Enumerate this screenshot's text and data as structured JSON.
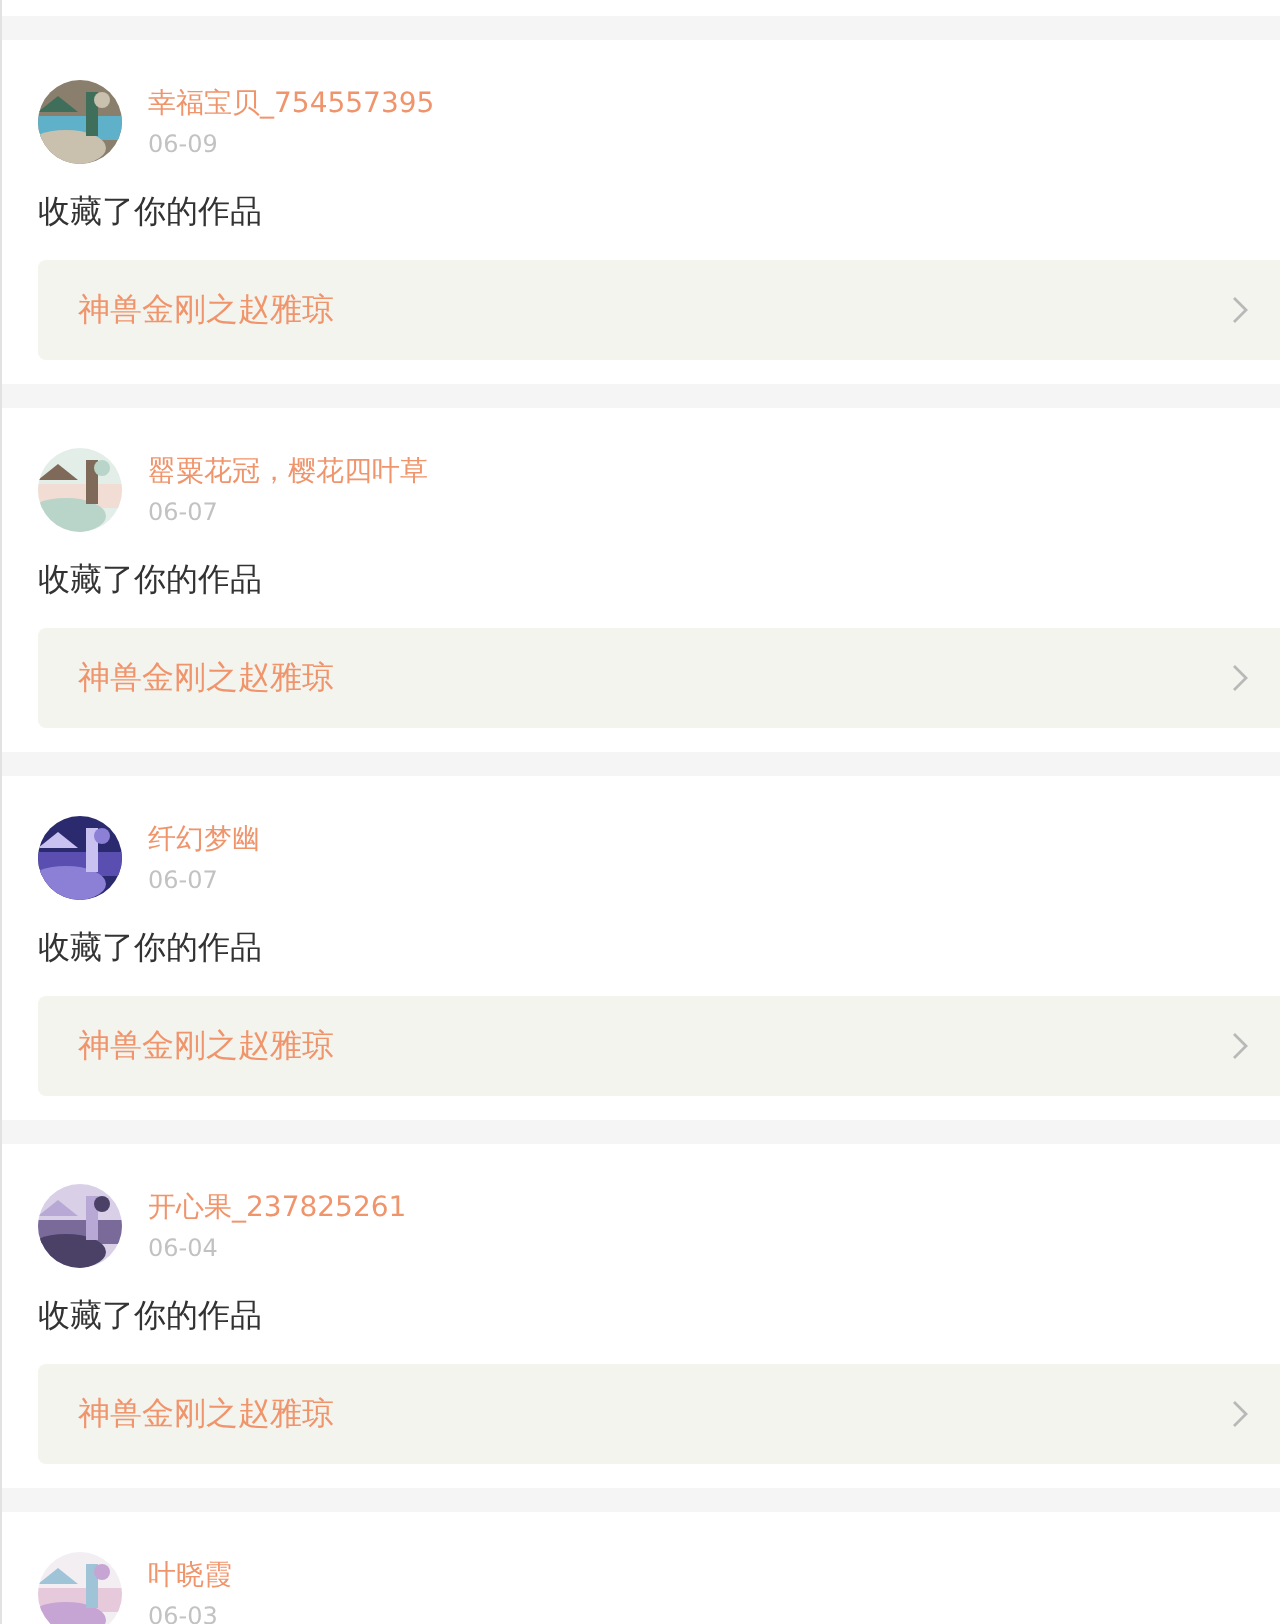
{
  "notifications": [
    {
      "user": "幸福宝贝_754557395",
      "date": "06-09",
      "action": "收藏了你的作品",
      "work": "神兽金刚之赵雅琼"
    },
    {
      "user": "罂粟花冠，樱花四叶草",
      "date": "06-07",
      "action": "收藏了你的作品",
      "work": "神兽金刚之赵雅琼"
    },
    {
      "user": "纤幻梦幽",
      "date": "06-07",
      "action": "收藏了你的作品",
      "work": "神兽金刚之赵雅琼"
    },
    {
      "user": "开心果_237825261",
      "date": "06-04",
      "action": "收藏了你的作品",
      "work": "神兽金刚之赵雅琼"
    },
    {
      "user": "叶晓霞",
      "date": "06-03"
    }
  ]
}
